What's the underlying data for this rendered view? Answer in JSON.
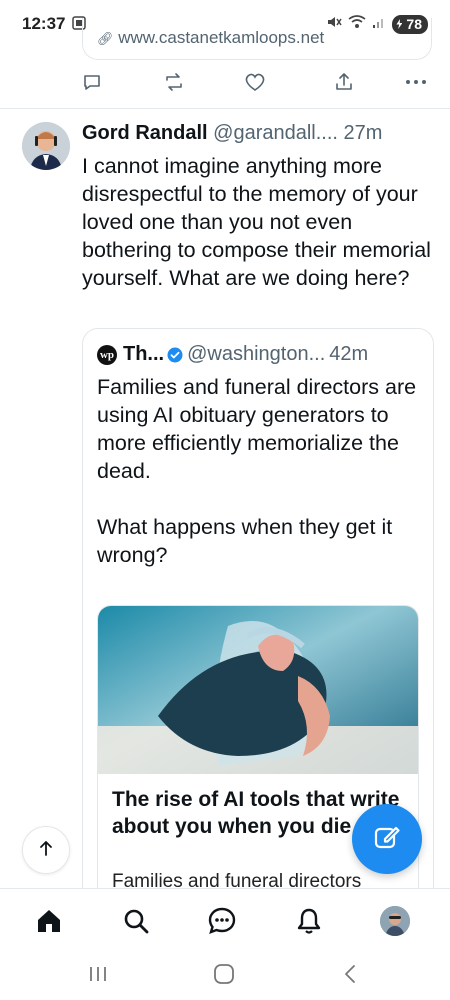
{
  "status_bar": {
    "time": "12:37",
    "battery": "78"
  },
  "prev_tweet": {
    "link_url": "www.castanetkamloops.net"
  },
  "tweet": {
    "author": "Gord Randall",
    "handle": "@garandall....",
    "time": "27m",
    "text": "I cannot imagine anything more disrespectful to the memory of your loved one than you not even bothering to compose their memorial yourself. What are we doing here?"
  },
  "quote": {
    "author": "Th...",
    "logo_text": "wp",
    "handle": "@washington...",
    "time": "42m",
    "text": "Families and funeral directors are using AI obituary generators to more efficiently memorialize the dead.\n\nWhat happens when they get it wrong?",
    "card": {
      "title": "The rise of AI tools that write about you when you die",
      "description": "Families and funeral directors"
    }
  },
  "colors": {
    "accent": "#1d8bf0",
    "text": "#0f1419",
    "muted": "#536471"
  },
  "icons": {
    "actions": [
      "reply-icon",
      "repost-icon",
      "like-icon",
      "share-icon",
      "more-icon"
    ],
    "nav": [
      "home-icon",
      "search-icon",
      "messages-icon",
      "notifications-icon",
      "profile-avatar"
    ],
    "system": [
      "recents-icon",
      "home-circle-icon",
      "back-icon"
    ]
  }
}
